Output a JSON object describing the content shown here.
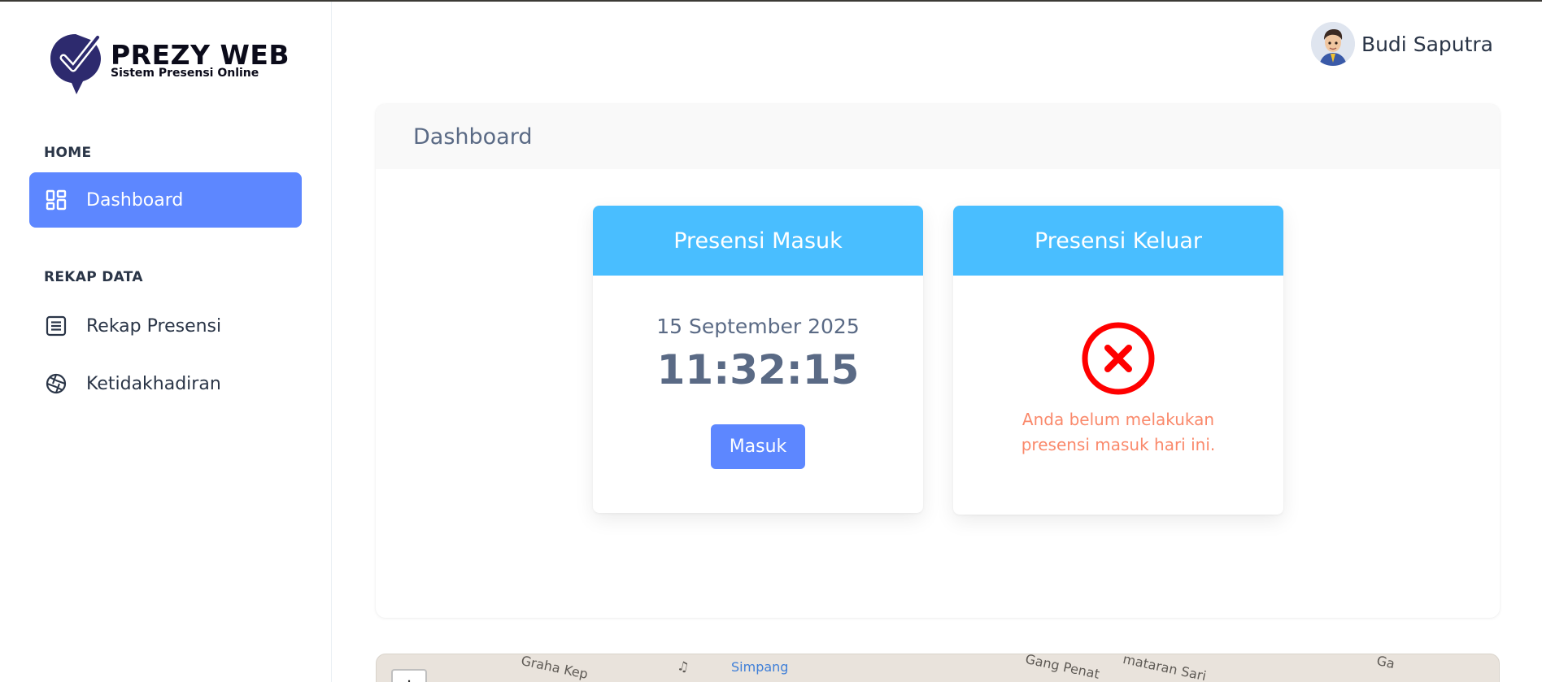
{
  "brand": {
    "name": "PREZY WEB",
    "tagline": "Sistem Presensi Online",
    "accent_color": "#2d2a6e"
  },
  "sidebar": {
    "sections": [
      {
        "caption": "HOME",
        "items": [
          {
            "label": "Dashboard",
            "icon": "dashboard-icon",
            "active": true
          }
        ]
      },
      {
        "caption": "REKAP DATA",
        "items": [
          {
            "label": "Rekap Presensi",
            "icon": "list-icon",
            "active": false
          },
          {
            "label": "Ketidakhadiran",
            "icon": "aperture-icon",
            "active": false
          }
        ]
      }
    ]
  },
  "header": {
    "user_name": "Budi Saputra",
    "avatar_icon": "avatar-icon"
  },
  "main": {
    "title": "Dashboard",
    "presensi_masuk": {
      "title": "Presensi Masuk",
      "date": "15 September 2025",
      "time": "11:32:15",
      "button_label": "Masuk"
    },
    "presensi_keluar": {
      "title": "Presensi Keluar",
      "status_icon": "close-circle-icon",
      "message": "Anda belum melakukan presensi masuk hari ini."
    }
  },
  "map": {
    "labels": [
      "Graha Kep",
      "Simpang",
      "Gang Penat",
      "mataran Sari",
      "Ga"
    ],
    "zoom_in_label": "+"
  },
  "colors": {
    "primary": "#5d87ff",
    "info": "#49beff",
    "error": "#fa896b",
    "danger_icon": "#ff0000"
  }
}
